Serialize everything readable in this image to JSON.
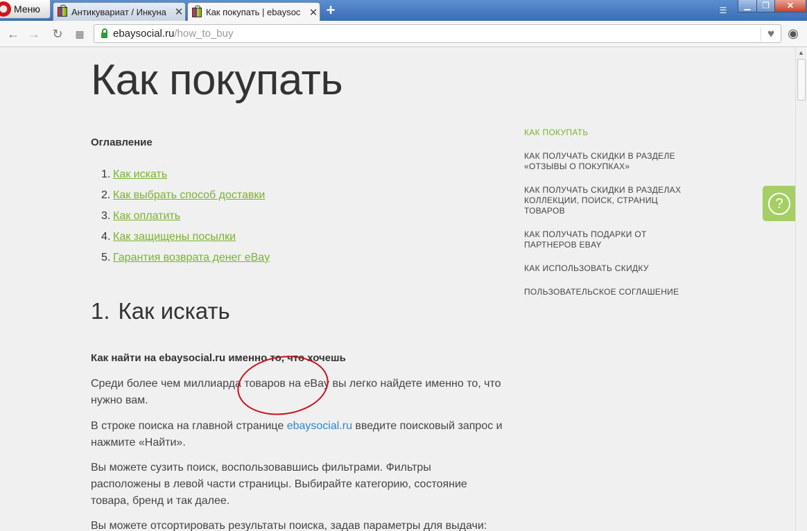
{
  "browser": {
    "menu_label": "Меню",
    "tabs": [
      {
        "title": "Антикувариат / Инкуна",
        "active": false
      },
      {
        "title": "Как покупать | ebaysoc",
        "active": true
      }
    ],
    "new_tab": "+",
    "address": {
      "host": "ebaysocial.ru",
      "path": "/how_to_buy"
    }
  },
  "page": {
    "title": "Как покупать",
    "toc_heading": "Оглавление",
    "toc": [
      {
        "num": "1.",
        "label": "Как искать"
      },
      {
        "num": "2.",
        "label": "Как выбрать способ доставки"
      },
      {
        "num": "3.",
        "label": "Как оплатить"
      },
      {
        "num": "4.",
        "label": "Как защищены посылки"
      },
      {
        "num": "5.",
        "label": "Гарантия возврата денег eBay"
      }
    ],
    "section": {
      "num": "1.",
      "title": "Как искать"
    },
    "subheading": "Как найти на ebaysocial.ru именно то, что хочешь",
    "paragraphs": [
      {
        "text": "Среди более чем миллиарда товаров на eBay вы легко найдете именно то, что нужно вам."
      },
      {
        "before": "В строке поиска на главной странице ",
        "link": "ebaysocial.ru",
        "after": " введите поисковый запрос и нажмите «Найти»."
      },
      {
        "text": "Вы можете сузить поиск, воспользовавшись фильтрами. Фильтры расположены в левой части страницы. Выбирайте категорию, состояние товара, бренд и так далее."
      },
      {
        "text": "Вы можете отсортировать результаты поиска, задав параметры для выдачи:"
      }
    ],
    "side_nav": [
      {
        "label": "КАК ПОКУПАТЬ",
        "current": true
      },
      {
        "label": "КАК ПОЛУЧАТЬ СКИДКИ В РАЗДЕЛЕ «ОТЗЫВЫ О ПОКУПКАХ»",
        "current": false
      },
      {
        "label": "КАК ПОЛУЧАТЬ СКИДКИ В РАЗДЕЛАХ КОЛЛЕКЦИИ, ПОИСК, СТРАНИЦ ТОВАРОВ",
        "current": false
      },
      {
        "label": "КАК ПОЛУЧАТЬ ПОДАРКИ ОТ ПАРТНЕРОВ EBAY",
        "current": false
      },
      {
        "label": "КАК ИСПОЛЬЗОВАТЬ СКИДКУ",
        "current": false
      },
      {
        "label": "ПОЛЬЗОВАТЕЛЬСКОЕ СОГЛАШЕНИЕ",
        "current": false
      }
    ],
    "help_icon": "?"
  },
  "colors": {
    "accent_green": "#78b32d",
    "link_blue": "#2f86c9",
    "annotation_red": "#c8101e"
  }
}
